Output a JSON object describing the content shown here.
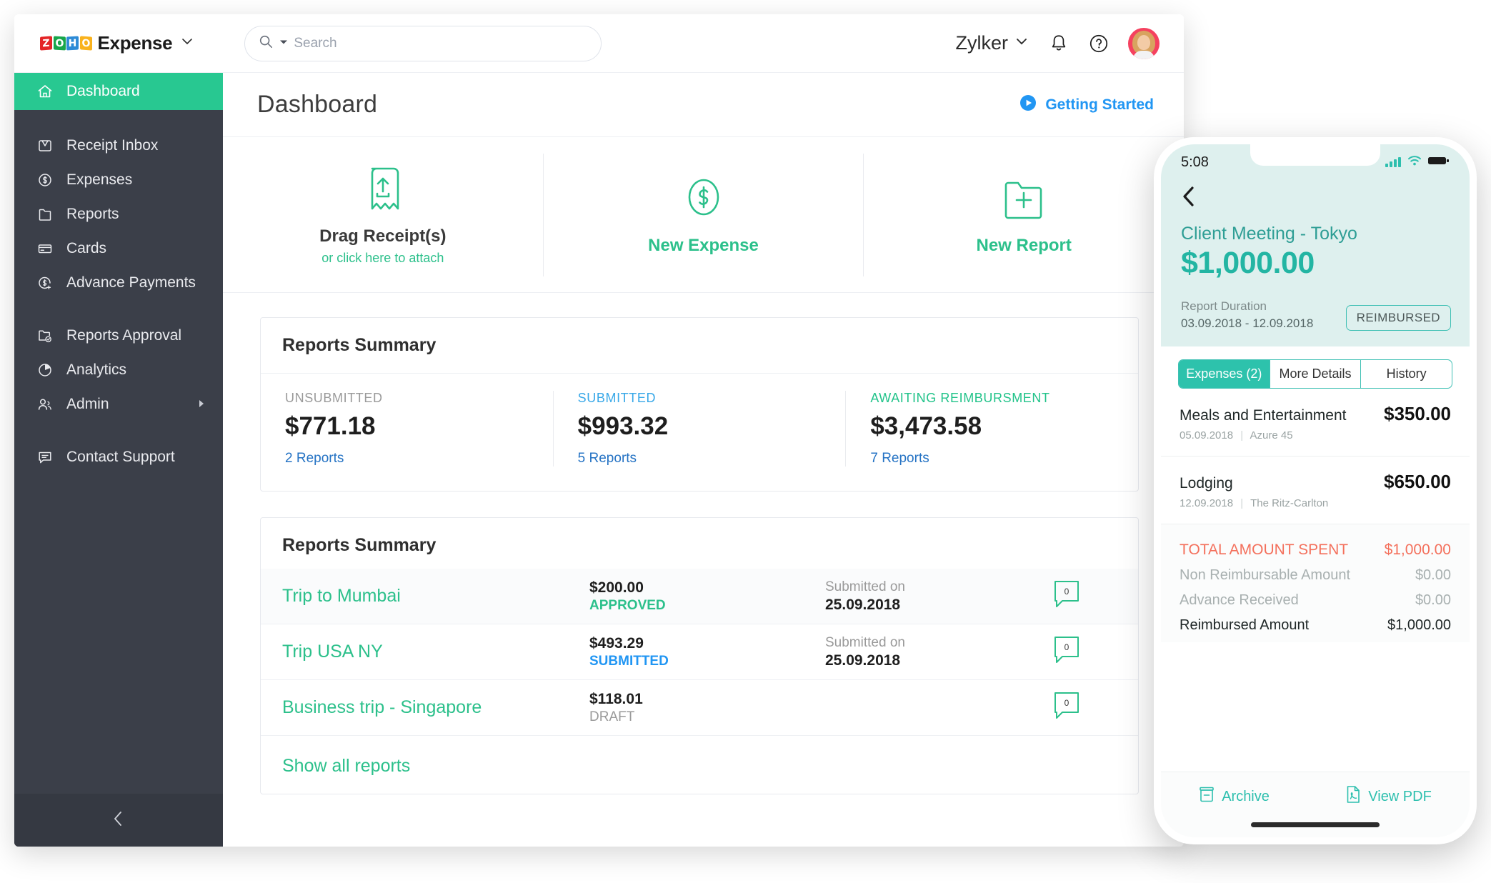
{
  "brand": {
    "zoho_letters": [
      "Z",
      "O",
      "H",
      "O"
    ],
    "product": "Expense",
    "colors": [
      "#e42527",
      "#18a64b",
      "#2c8ad6",
      "#f9b21d"
    ]
  },
  "search": {
    "placeholder": "Search",
    "value": ""
  },
  "header": {
    "org": "Zylker",
    "bell_icon": "bell-icon",
    "help_icon": "help-icon",
    "avatar_alt": "user-avatar"
  },
  "sidebar": {
    "items": [
      {
        "label": "Dashboard",
        "icon": "home-icon",
        "active": true
      },
      {
        "label": "Receipt Inbox",
        "icon": "inbox-icon",
        "active": false
      },
      {
        "label": "Expenses",
        "icon": "dollar-circle-icon",
        "active": false
      },
      {
        "label": "Reports",
        "icon": "folder-icon",
        "active": false
      },
      {
        "label": "Cards",
        "icon": "card-icon",
        "active": false
      },
      {
        "label": "Advance Payments",
        "icon": "dollar-plus-icon",
        "active": false
      },
      {
        "label": "Reports Approval",
        "icon": "folder-check-icon",
        "active": false
      },
      {
        "label": "Analytics",
        "icon": "pie-chart-icon",
        "active": false
      },
      {
        "label": "Admin",
        "icon": "users-icon",
        "active": false,
        "caret": true
      },
      {
        "label": "Contact Support",
        "icon": "chat-icon",
        "active": false
      }
    ],
    "collapse_icon": "chevron-left-icon"
  },
  "page": {
    "title": "Dashboard",
    "getting_started": "Getting Started",
    "play_icon": "play-circle-icon"
  },
  "quick_actions": [
    {
      "icon": "receipt-upload-icon",
      "label": "Drag Receipt(s)",
      "sub": "or click here to attach"
    },
    {
      "icon": "dollar-oval-icon",
      "label": "New Expense",
      "sub": ""
    },
    {
      "icon": "folder-plus-icon",
      "label": "New Report",
      "sub": ""
    }
  ],
  "reports_summary": {
    "title": "Reports Summary",
    "stats": [
      {
        "label": "UNSUBMITTED",
        "value": "$771.18",
        "link": "2 Reports",
        "color": "#9a9a9a"
      },
      {
        "label": "SUBMITTED",
        "value": "$993.32",
        "link": "5 Reports",
        "color": "#38a8e8"
      },
      {
        "label": "AWAITING REIMBURSMENT",
        "value": "$3,473.58",
        "link": "7 Reports",
        "color": "#22c38a"
      }
    ]
  },
  "reports_list": {
    "title": "Reports Summary",
    "rows": [
      {
        "name": "Trip to Mumbai",
        "amount": "$200.00",
        "status": "APPROVED",
        "status_class": "approved",
        "date_label": "Submitted on",
        "date": "25.09.2018",
        "comments": "0"
      },
      {
        "name": "Trip USA NY",
        "amount": "$493.29",
        "status": "SUBMITTED",
        "status_class": "submitted",
        "date_label": "Submitted on",
        "date": "25.09.2018",
        "comments": "0"
      },
      {
        "name": "Business trip - Singapore",
        "amount": "$118.01",
        "status": "DRAFT",
        "status_class": "draft",
        "date_label": "",
        "date": "",
        "comments": "0"
      }
    ],
    "show_all": "Show all reports"
  },
  "phone": {
    "status": {
      "time": "5:08",
      "signal_icon": "signal-icon",
      "wifi_icon": "wifi-icon",
      "battery_icon": "battery-icon"
    },
    "back_icon": "chevron-left-icon",
    "report_title": "Client Meeting - Tokyo",
    "report_amount": "$1,000.00",
    "duration_label": "Report Duration",
    "duration_value": "03.09.2018 - 12.09.2018",
    "badge": "REIMBURSED",
    "tabs": [
      {
        "label": "Expenses (2)",
        "active": true
      },
      {
        "label": "More Details",
        "active": false
      },
      {
        "label": "History",
        "active": false
      }
    ],
    "expenses": [
      {
        "name": "Meals and Entertainment",
        "amount": "$350.00",
        "date": "05.09.2018",
        "merchant": "Azure 45"
      },
      {
        "name": "Lodging",
        "amount": "$650.00",
        "date": "12.09.2018",
        "merchant": "The Ritz-Carlton"
      }
    ],
    "totals": [
      {
        "label": "TOTAL AMOUNT SPENT",
        "value": "$1,000.00",
        "style": "total"
      },
      {
        "label": "Non Reimbursable Amount",
        "value": "$0.00",
        "style": "muted"
      },
      {
        "label": "Advance Received",
        "value": "$0.00",
        "style": "muted"
      },
      {
        "label": "Reimbursed Amount",
        "value": "$1,000.00",
        "style": "strong"
      }
    ],
    "actions": [
      {
        "label": "Archive",
        "icon": "archive-icon"
      },
      {
        "label": "View PDF",
        "icon": "pdf-icon"
      }
    ]
  },
  "colors": {
    "accent_green": "#2cc08b",
    "sidebar_bg": "#3b3f49",
    "active_green": "#28c891",
    "teal": "#2dc2ac",
    "blue": "#2196f3",
    "coral": "#f4705c"
  }
}
